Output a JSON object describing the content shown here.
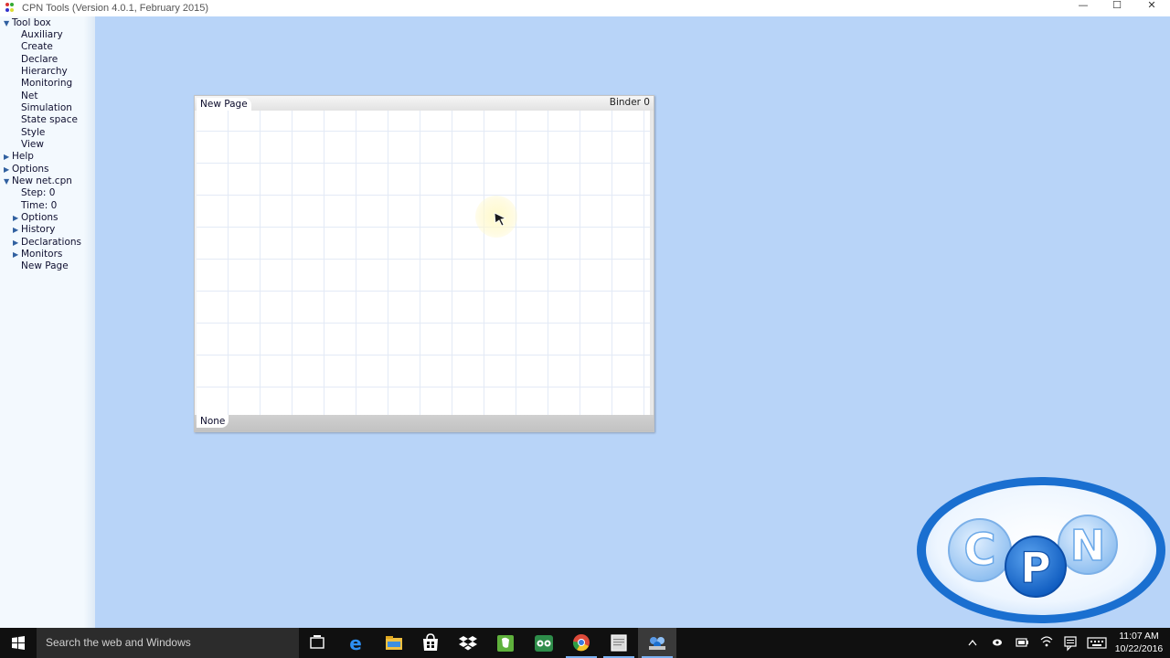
{
  "window": {
    "title": "CPN Tools (Version 4.0.1, February 2015)",
    "minimize": "—",
    "maximize": "☐",
    "close": "✕"
  },
  "tree": {
    "toolbox": "Tool box",
    "toolbox_items": [
      "Auxiliary",
      "Create",
      "Declare",
      "Hierarchy",
      "Monitoring",
      "Net",
      "Simulation",
      "State space",
      "Style",
      "View"
    ],
    "help": "Help",
    "options": "Options",
    "net_name": "New net.cpn",
    "step": "Step: 0",
    "time": "Time: 0",
    "net_options": "Options",
    "history": "History",
    "declarations": "Declarations",
    "monitors": "Monitors",
    "page": "New Page"
  },
  "binder": {
    "label": "Binder 0",
    "page_tab": "New Page",
    "bottom_tab": "None"
  },
  "logo": {
    "letters": [
      "C",
      "P",
      "N"
    ]
  },
  "taskbar": {
    "search_placeholder": "Search the web and Windows",
    "apps": [
      "task-view-icon",
      "edge-icon",
      "file-explorer-icon",
      "store-icon",
      "dropbox-icon",
      "evernote-icon",
      "tripadvisor-icon",
      "chrome-icon",
      "notes-icon",
      "cpn-tools-icon"
    ],
    "time": "11:07 AM",
    "date": "10/22/2016"
  },
  "colors": {
    "canvas": "#b8d4f8",
    "panel": "#f3f9fe",
    "taskbar": "#101010",
    "logo_blue": "#1a6fd0"
  }
}
